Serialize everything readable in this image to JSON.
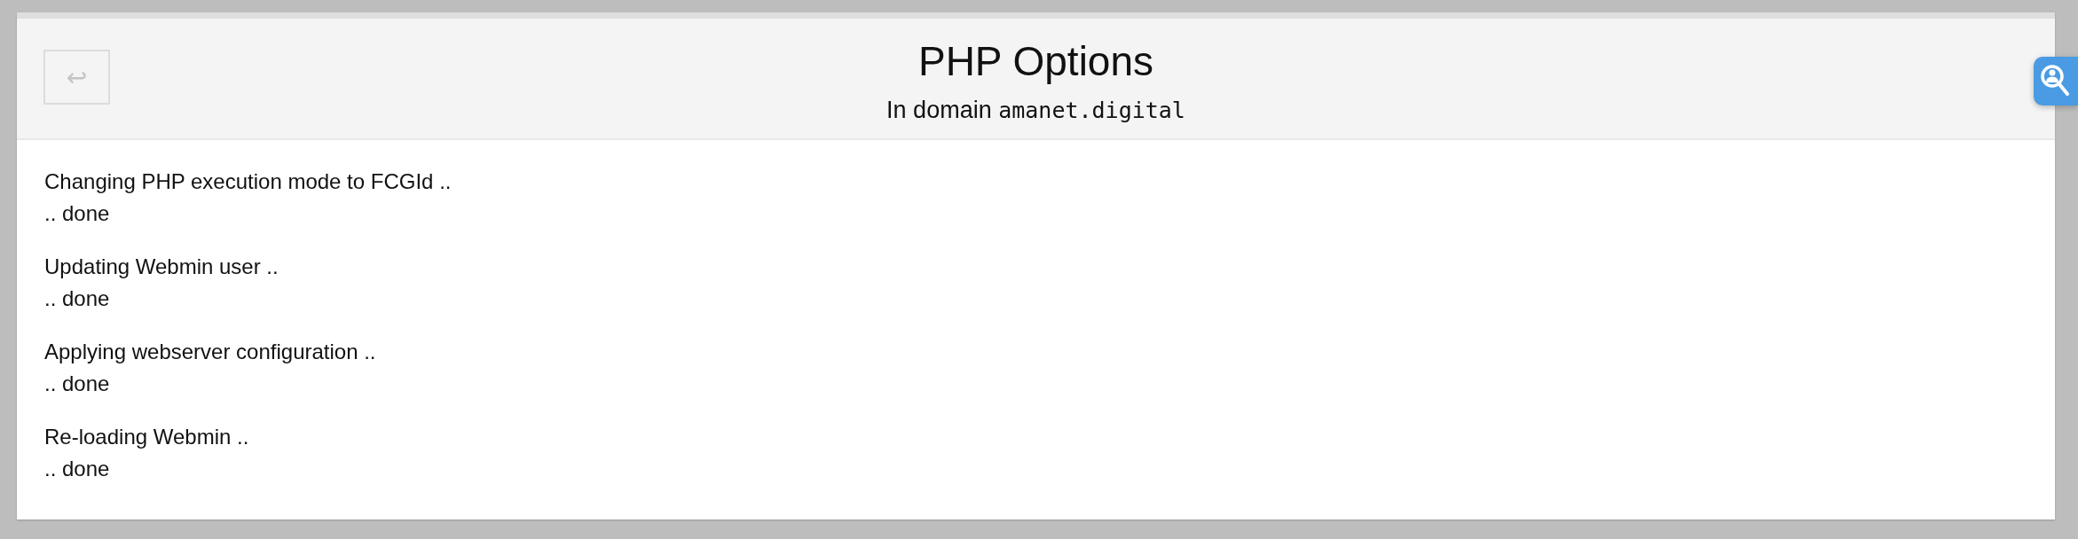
{
  "header": {
    "back_button": {
      "label": "↩"
    },
    "title": "PHP Options",
    "subtitle": {
      "text": "In domain",
      "domain": "amanet.digital"
    }
  },
  "steps": [
    {
      "action": "Changing PHP execution mode to FCGId ..",
      "result": ".. done"
    },
    {
      "action": "Updating Webmin user ..",
      "result": ".. done"
    },
    {
      "action": "Applying webserver configuration ..",
      "result": ".. done"
    },
    {
      "action": "Re-loading Webmin ..",
      "result": ".. done"
    }
  ]
}
